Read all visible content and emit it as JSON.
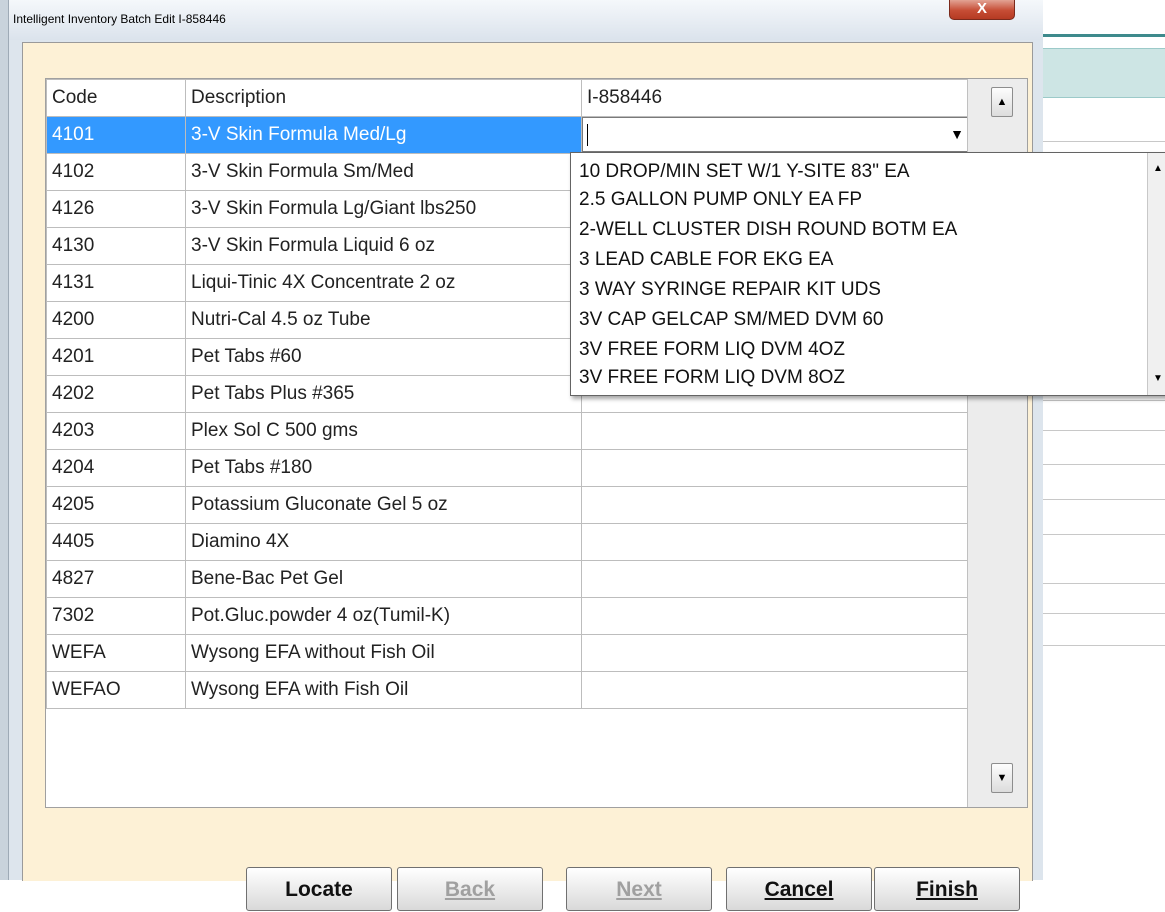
{
  "window": {
    "title": "Intelligent Inventory Batch Edit I-858446",
    "close_label": "X"
  },
  "grid": {
    "columns": [
      "Code",
      "Description",
      "I-858446"
    ],
    "rows": [
      {
        "code": "4101",
        "description": "3-V Skin Formula Med/Lg",
        "value": ""
      },
      {
        "code": "4102",
        "description": "3-V Skin Formula Sm/Med",
        "value": ""
      },
      {
        "code": "4126",
        "description": "3-V Skin Formula Lg/Giant lbs250",
        "value": ""
      },
      {
        "code": "4130",
        "description": "3-V Skin Formula Liquid 6 oz",
        "value": ""
      },
      {
        "code": "4131",
        "description": "Liqui-Tinic 4X Concentrate 2 oz",
        "value": ""
      },
      {
        "code": "4200",
        "description": "Nutri-Cal 4.5 oz Tube",
        "value": ""
      },
      {
        "code": "4201",
        "description": "Pet Tabs #60",
        "value": ""
      },
      {
        "code": "4202",
        "description": "Pet Tabs Plus #365",
        "value": ""
      },
      {
        "code": "4203",
        "description": "Plex Sol C 500 gms",
        "value": ""
      },
      {
        "code": "4204",
        "description": "Pet Tabs #180",
        "value": ""
      },
      {
        "code": "4205",
        "description": "Potassium Gluconate Gel 5 oz",
        "value": ""
      },
      {
        "code": "4405",
        "description": "Diamino 4X",
        "value": ""
      },
      {
        "code": "4827",
        "description": "Bene-Bac Pet Gel",
        "value": ""
      },
      {
        "code": "7302",
        "description": "Pot.Gluc.powder 4 oz(Tumil-K)",
        "value": ""
      },
      {
        "code": "WEFA",
        "description": "Wysong EFA without Fish Oil",
        "value": ""
      },
      {
        "code": "WEFAO",
        "description": "Wysong EFA with Fish Oil",
        "value": ""
      }
    ],
    "selected_row": 0,
    "combo_value": ""
  },
  "dropdown": {
    "options": [
      "10 DROP/MIN SET W/1 Y-SITE 83\" EA",
      "2.5 GALLON PUMP ONLY EA FP",
      "2-WELL CLUSTER DISH ROUND BOTM EA",
      "3 LEAD CABLE FOR EKG EA",
      "3 WAY SYRINGE REPAIR KIT UDS",
      "3V CAP GELCAP SM/MED DVM 60",
      "3V FREE FORM LIQ DVM 4OZ",
      "3V FREE FORM LIQ DVM 8OZ"
    ]
  },
  "buttons": {
    "locate": "Locate",
    "back": "Back",
    "next": "Next",
    "cancel": "Cancel",
    "finish": "Finish",
    "back_enabled": false,
    "next_enabled": false
  },
  "icons": {
    "combo_arrow": "dropdown-arrow-icon",
    "scroll_up": "scroll-up-arrow-icon",
    "scroll_down": "scroll-down-arrow-icon"
  },
  "colors": {
    "selection": "#3399ff",
    "frame_background": "#fdf1d6",
    "close_button": "#c64d35"
  }
}
